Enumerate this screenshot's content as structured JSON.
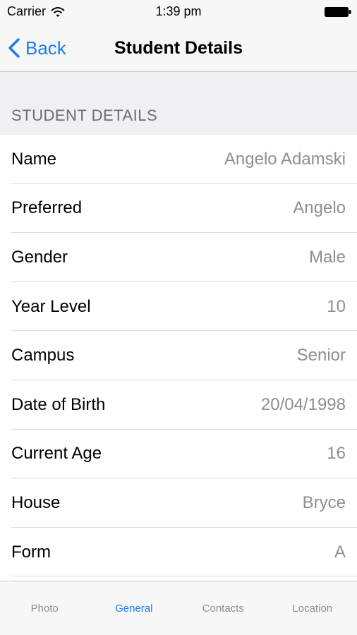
{
  "status_bar": {
    "carrier": "Carrier",
    "time": "1:39 pm"
  },
  "nav": {
    "back_label": "Back",
    "title": "Student Details"
  },
  "section": {
    "title": "STUDENT DETAILS"
  },
  "rows": [
    {
      "label": "Name",
      "value": "Angelo Adamski"
    },
    {
      "label": "Preferred",
      "value": "Angelo"
    },
    {
      "label": "Gender",
      "value": "Male"
    },
    {
      "label": "Year Level",
      "value": "10"
    },
    {
      "label": "Campus",
      "value": "Senior"
    },
    {
      "label": "Date of Birth",
      "value": "20/04/1998"
    },
    {
      "label": "Current Age",
      "value": "16"
    },
    {
      "label": "House",
      "value": "Bryce"
    },
    {
      "label": "Form",
      "value": "A"
    }
  ],
  "tabs": [
    {
      "label": "Photo",
      "active": false
    },
    {
      "label": "General",
      "active": true
    },
    {
      "label": "Contacts",
      "active": false
    },
    {
      "label": "Location",
      "active": false
    }
  ],
  "colors": {
    "accent": "#1a7cf5",
    "secondary_text": "#8e8e93",
    "group_background": "#efeff4"
  },
  "icons": {
    "wifi": "wifi-icon",
    "battery": "battery-icon",
    "back": "chevron-left-icon"
  }
}
